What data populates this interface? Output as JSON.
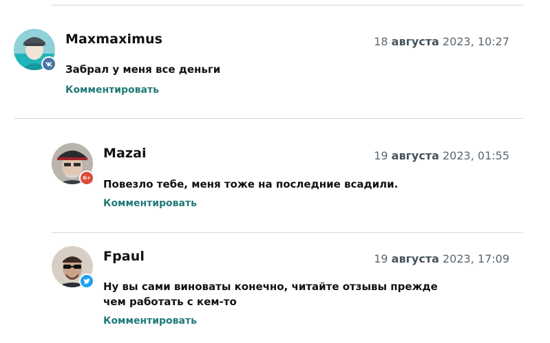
{
  "comments": [
    {
      "author": "Maxmaximus",
      "date_day": "18",
      "date_month": "августа",
      "date_rest": "2023, 10:27",
      "text": "Забрал у меня все деньги",
      "reply_label": "Комментировать",
      "badge": "vk",
      "badge_color": "#4a76a8"
    },
    {
      "author": "Mazai",
      "date_day": "19",
      "date_month": "августа",
      "date_rest": "2023, 01:55",
      "text": "Повезло тебе, меня тоже на последние всадили.",
      "reply_label": "Комментировать",
      "badge": "google-plus",
      "badge_label": "G+",
      "badge_color": "#dd4b39"
    },
    {
      "author": "Fpaul",
      "date_day": "19",
      "date_month": "августа",
      "date_rest": "2023, 17:09",
      "text": "Ну вы сами виноваты конечно, читайте отзывы прежде чем работать с кем-то",
      "reply_label": "Комментировать",
      "badge": "twitter",
      "badge_color": "#1da1f2"
    }
  ],
  "colors": {
    "link": "#1f7a78",
    "date": "#5a6670",
    "divider": "#d6d6d6"
  }
}
